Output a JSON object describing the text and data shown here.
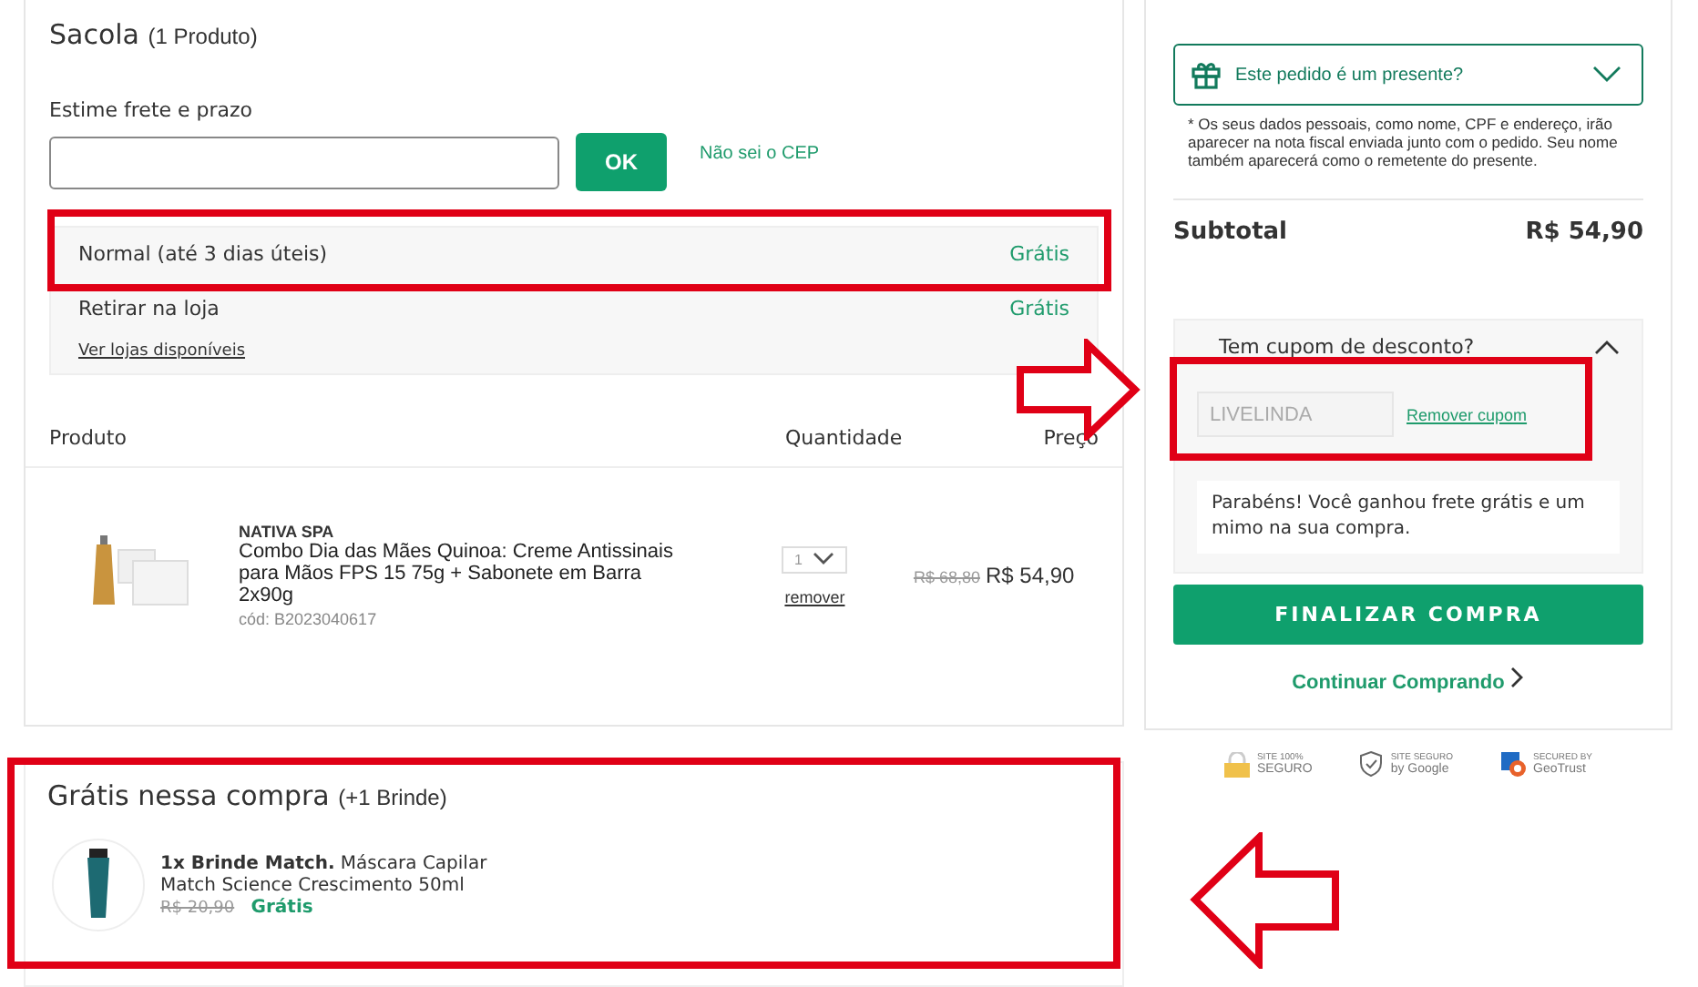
{
  "cart": {
    "title": "Sacola",
    "count": "(1 Produto)",
    "shipping": {
      "label": "Estime frete e prazo",
      "ok_button": "OK",
      "cep_link": "Não sei o CEP",
      "options": [
        {
          "name": "Normal (até 3 dias úteis)",
          "price": "Grátis"
        },
        {
          "name": "Retirar na loja",
          "price": "Grátis",
          "link": "Ver lojas disponíveis"
        }
      ]
    },
    "columns": [
      "Produto",
      "Quantidade",
      "Preço"
    ],
    "items": [
      {
        "brand": "NATIVA SPA",
        "name": "Combo Dia das Mães Quinoa: Creme Antissinais para Mãos FPS 15 75g + Sabonete em Barra 2x90g",
        "code": "cód: B2023040617",
        "quantity": "1",
        "remove": "remover",
        "old_price": "R$ 68,80",
        "price": "R$ 54,90"
      }
    ]
  },
  "gifts": {
    "title": "Grátis nessa compra",
    "count": "(+1 Brinde)",
    "items": [
      {
        "text": "**1x Brinde Match.** Máscara Capilar Match Science Crescimento 50ml",
        "old_price": "R$ 20,90",
        "price": "Grátis"
      }
    ]
  },
  "summary": {
    "gift_toggle": {
      "label": "Este pedido é um presente?",
      "expanded": false
    },
    "gift_note": "* Os seus dados pessoais, como nome, CPF e endereço, irão aparecer na nota fiscal enviada junto com o pedido. Seu nome também aparecerá como o remetente do presente.",
    "subtotal_label": "Subtotal",
    "subtotal": "R$ 54,90",
    "coupon": {
      "title": "Tem cupom de desconto?",
      "expanded": true,
      "code": "LIVELINDA",
      "remove": "Remover cupom",
      "message": "Parabéns! Você ganhou frete grátis e um mimo na sua compra."
    },
    "checkout_button": "FINALIZAR COMPRA",
    "continue_link": "Continuar Comprando",
    "badges": [
      {
        "kind": "lock",
        "top": "SITE 100%",
        "bottom": "SEGURO"
      },
      {
        "kind": "shield",
        "top": "SITE SEGURO",
        "bottom": "by Google"
      },
      {
        "kind": "geotrust",
        "top": "SECURED BY",
        "bottom": "GeoTrust"
      }
    ]
  }
}
